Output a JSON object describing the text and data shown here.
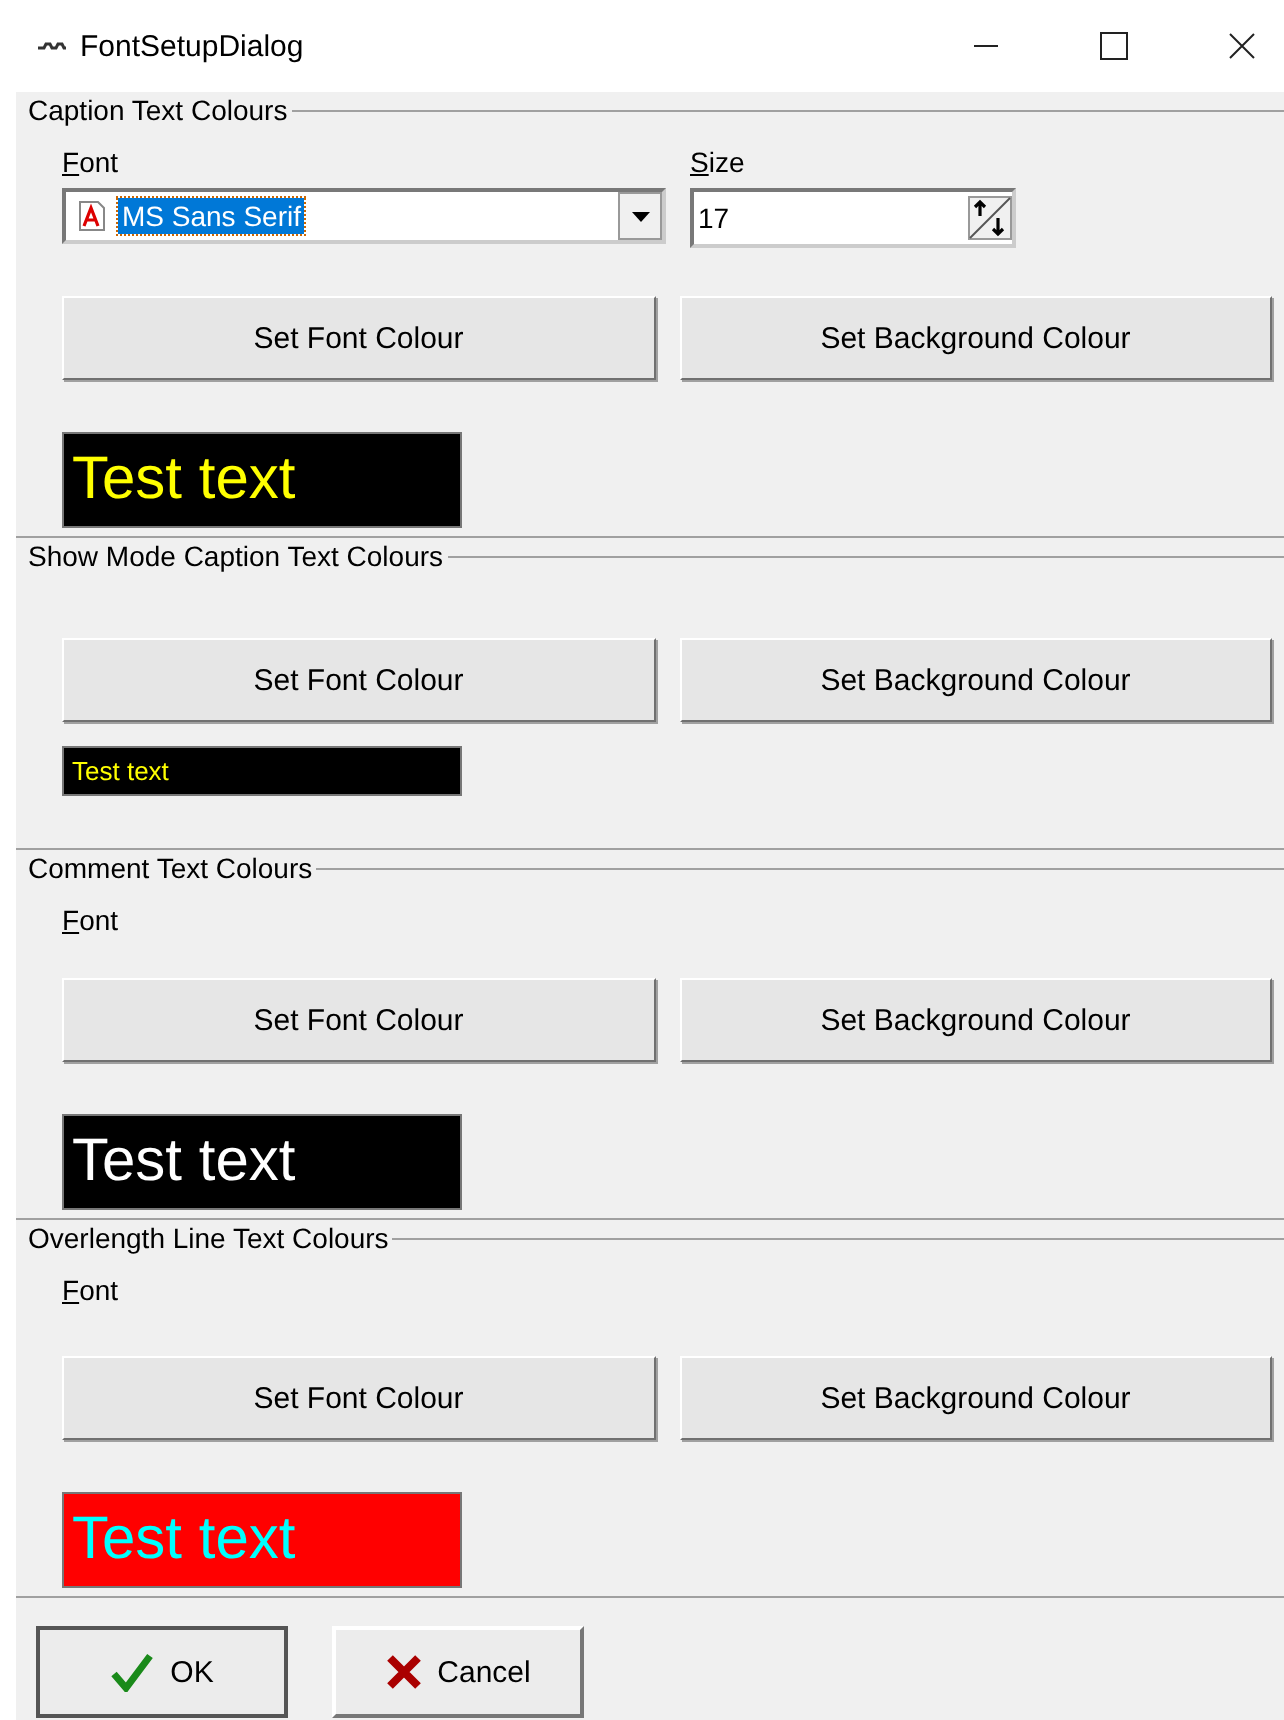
{
  "window": {
    "title": "FontSetupDialog"
  },
  "sections": [
    {
      "title": "Caption Text Colours",
      "font_label": "Font",
      "font_select": {
        "value": "MS Sans Serif",
        "size_label": "Size",
        "size_value": "17"
      },
      "buttons": [
        "Set Font Colour",
        "Set Background Colour"
      ],
      "preview": {
        "kind": "large",
        "color": "#000000",
        "text": {
          "label": "Test text",
          "color": "#ffff00"
        }
      }
    },
    {
      "title": "Show Mode Caption Text Colours",
      "buttons": [
        "Set Font Colour",
        "Set Background Colour"
      ],
      "preview": {
        "kind": "small",
        "color": "#000000",
        "text": {
          "label": "Test text",
          "color": "#ffff00"
        }
      }
    },
    {
      "title": "Comment Text Colours",
      "font_label": "Font",
      "buttons": [
        "Set Font Colour",
        "Set Background Colour"
      ],
      "preview": {
        "kind": "large",
        "color": "#000000",
        "text": {
          "label": "Test text",
          "color": "#ffffff"
        }
      }
    },
    {
      "title": "Overlength Line Text Colours",
      "font_label": "Font",
      "buttons": [
        "Set Font Colour",
        "Set Background Colour"
      ],
      "preview": {
        "kind": "large",
        "color": "#ff0000",
        "text": {
          "label": "Test text",
          "color": "#00ffff"
        }
      }
    }
  ],
  "footer_buttons": [
    {
      "label": "OK",
      "kind": "ok"
    },
    {
      "label": "Cancel",
      "kind": "cancel"
    }
  ]
}
